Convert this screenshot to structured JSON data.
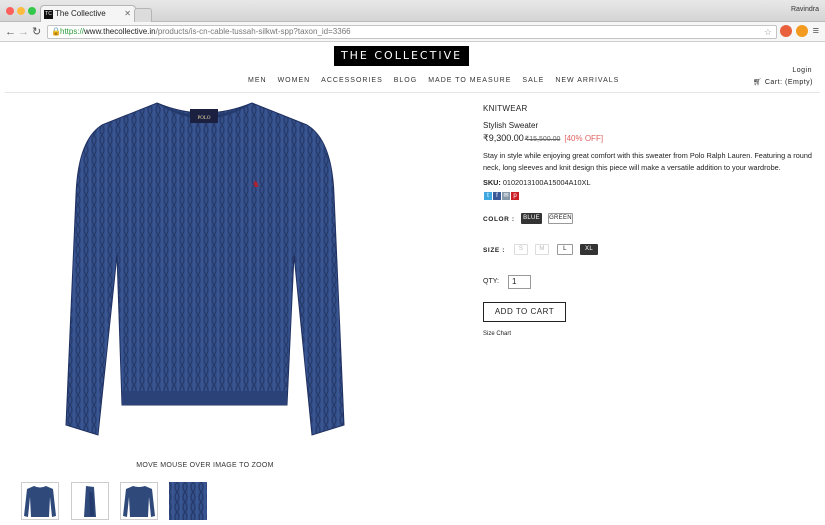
{
  "browser": {
    "tab_title": "The Collective",
    "tab_favicon": "TC",
    "user_name": "Ravindra",
    "url_scheme": "https://",
    "url_host": "www.thecollective.in",
    "url_path": "/products/is-cn-cable-tussah-silkwt-spp?taxon_id=3366"
  },
  "site": {
    "logo_text": "THE COLLECTIVE",
    "nav": [
      "MEN",
      "WOMEN",
      "ACCESSORIES",
      "BLOG",
      "MADE TO MEASURE",
      "SALE",
      "NEW ARRIVALS"
    ],
    "login": "Login",
    "cart": "Cart: (Empty)"
  },
  "gallery": {
    "zoom_hint": "MOVE MOUSE OVER IMAGE TO ZOOM",
    "sweater_color": "#2f4a7a",
    "thumbnails": [
      "front",
      "side",
      "back",
      "detail"
    ]
  },
  "product": {
    "category": "KNITWEAR",
    "name": "Stylish Sweater",
    "price": "₹9,300.00",
    "old_price": "₹15,500.00",
    "discount": "[40% OFF]",
    "description": "Stay in style while enjoying great comfort with this sweater from Polo Ralph Lauren. Featuring a round neck, long sleeves and knit design this piece will make a versatile addition to your wardrobe.",
    "sku_label": "SKU:",
    "sku": "0102013100A15004A10XL",
    "color_label": "COLOR :",
    "colors": [
      "BLUE",
      "GREEN"
    ],
    "selected_color": "BLUE",
    "size_label": "SIZE :",
    "sizes": [
      "S",
      "M",
      "L",
      "XL"
    ],
    "selected_size": "XL",
    "qty_label": "QTY:",
    "qty": "1",
    "add_to_cart": "ADD TO CART",
    "size_chart": "Size Chart"
  }
}
